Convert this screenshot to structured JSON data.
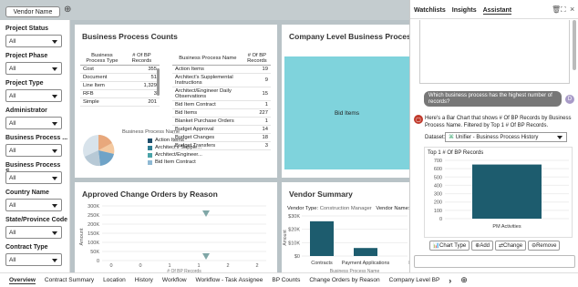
{
  "top": {
    "tab_label": "Vendor Name"
  },
  "filters": [
    {
      "label": "Project Status",
      "value": "All"
    },
    {
      "label": "Project Phase",
      "value": "All"
    },
    {
      "label": "Project Type",
      "value": "All"
    },
    {
      "label": "Administrator",
      "value": "All"
    },
    {
      "label": "Business Process ...",
      "value": "All"
    },
    {
      "label": "Business Process S...",
      "value": "All"
    },
    {
      "label": "Country Name",
      "value": "All"
    },
    {
      "label": "State/Province Code",
      "value": "All"
    },
    {
      "label": "Contract Type",
      "value": "All"
    }
  ],
  "bp_counts": {
    "title": "Business Process Counts",
    "t1_headers": [
      "Business Process Type",
      "# Of BP Records"
    ],
    "t1_rows": [
      [
        "Cost",
        "355"
      ],
      [
        "Document",
        "51"
      ],
      [
        "Line Item",
        "1,329"
      ],
      [
        "RFB",
        "3"
      ],
      [
        "Simple",
        "201"
      ]
    ],
    "t2_headers": [
      "Business Process Name",
      "# Of BP Records"
    ],
    "t2_rows": [
      [
        "Action Items",
        "19"
      ],
      [
        "Architect's Supplemental Instructions",
        "9"
      ],
      [
        "Architect/Engineer Daily Observations",
        "15"
      ],
      [
        "Bid Item Contract",
        "1"
      ],
      [
        "Bid Items",
        "227"
      ],
      [
        "Blanket Purchase Orders",
        "1"
      ],
      [
        "Budget Approval",
        "14"
      ],
      [
        "Budget Changes",
        "18"
      ],
      [
        "Budget Transfers",
        "3"
      ]
    ],
    "legend_title": "Business Process Name",
    "legend": [
      "Action Items",
      "Architect's Supple...",
      "Architect/Engineer...",
      "Bid Item Contract"
    ]
  },
  "company_level": {
    "title": "Company Level Business Process Summ",
    "tile_label": "Bid Items"
  },
  "change_orders": {
    "title": "Approved Change Orders by Reason",
    "y_label": "Amount",
    "yticks": [
      "300K",
      "250K",
      "200K",
      "150K",
      "100K",
      "50K",
      "0"
    ],
    "xticks": [
      "0",
      "0",
      "1",
      "1",
      "2",
      "2"
    ],
    "x_label": "# Of BP Records"
  },
  "vendor_summary": {
    "title": "Vendor Summary",
    "vendor_type_label": "Vendor Type:",
    "vendor_type_value": "Construction Manager",
    "vendor_name_label": "Vendor Name:",
    "vendor_name_value": "A",
    "yticks": [
      "$30K",
      "$20K",
      "$10K",
      "$0"
    ],
    "y_label": "Amount",
    "xticks": [
      "Contracts",
      "Payment Applications",
      "I"
    ],
    "x_label": "Business Process Name"
  },
  "bottom_tabs": [
    "Overview",
    "Contract Summary",
    "Location",
    "History",
    "Workflow",
    "Workflow - Task Assignee",
    "BP Counts",
    "Change Orders by Reason",
    "Company Level BP"
  ],
  "assistant": {
    "tabs": [
      "Watchlists",
      "Insights",
      "Assistant"
    ],
    "question": "Which business process has the highest number of records?",
    "user_initial": "D",
    "answer": "Here's a Bar Chart that shows # Of BP Records by Business Process Name. Filtered by Top 1 # Of BP Records.",
    "dataset_label": "Dataset:",
    "dataset_value": "Unifier - Business Process History",
    "chart_title": "Top 1 # Of BP Records",
    "buttons": [
      "Chart Type",
      "Add",
      "Change",
      "Remove"
    ]
  },
  "chart_data": [
    {
      "type": "bar",
      "title": "Top 1 # Of BP Records",
      "categories": [
        "PM Activities"
      ],
      "values": [
        650
      ],
      "ylim": [
        0,
        700
      ],
      "yticks": [
        "700",
        "600",
        "500",
        "400",
        "300",
        "200",
        "100",
        "0"
      ]
    },
    {
      "type": "scatter",
      "title": "Approved Change Orders by Reason",
      "x": [
        1.3,
        1.3
      ],
      "y": [
        255000,
        20000
      ],
      "xlabel": "# Of BP Records",
      "ylabel": "Amount",
      "ylim": [
        0,
        300000
      ]
    },
    {
      "type": "bar",
      "title": "Vendor Summary",
      "categories": [
        "Contracts",
        "Payment Applications"
      ],
      "values": [
        26000,
        6000
      ],
      "ylabel": "Amount",
      "xlabel": "Business Process Name",
      "ylim": [
        0,
        30000
      ]
    }
  ]
}
